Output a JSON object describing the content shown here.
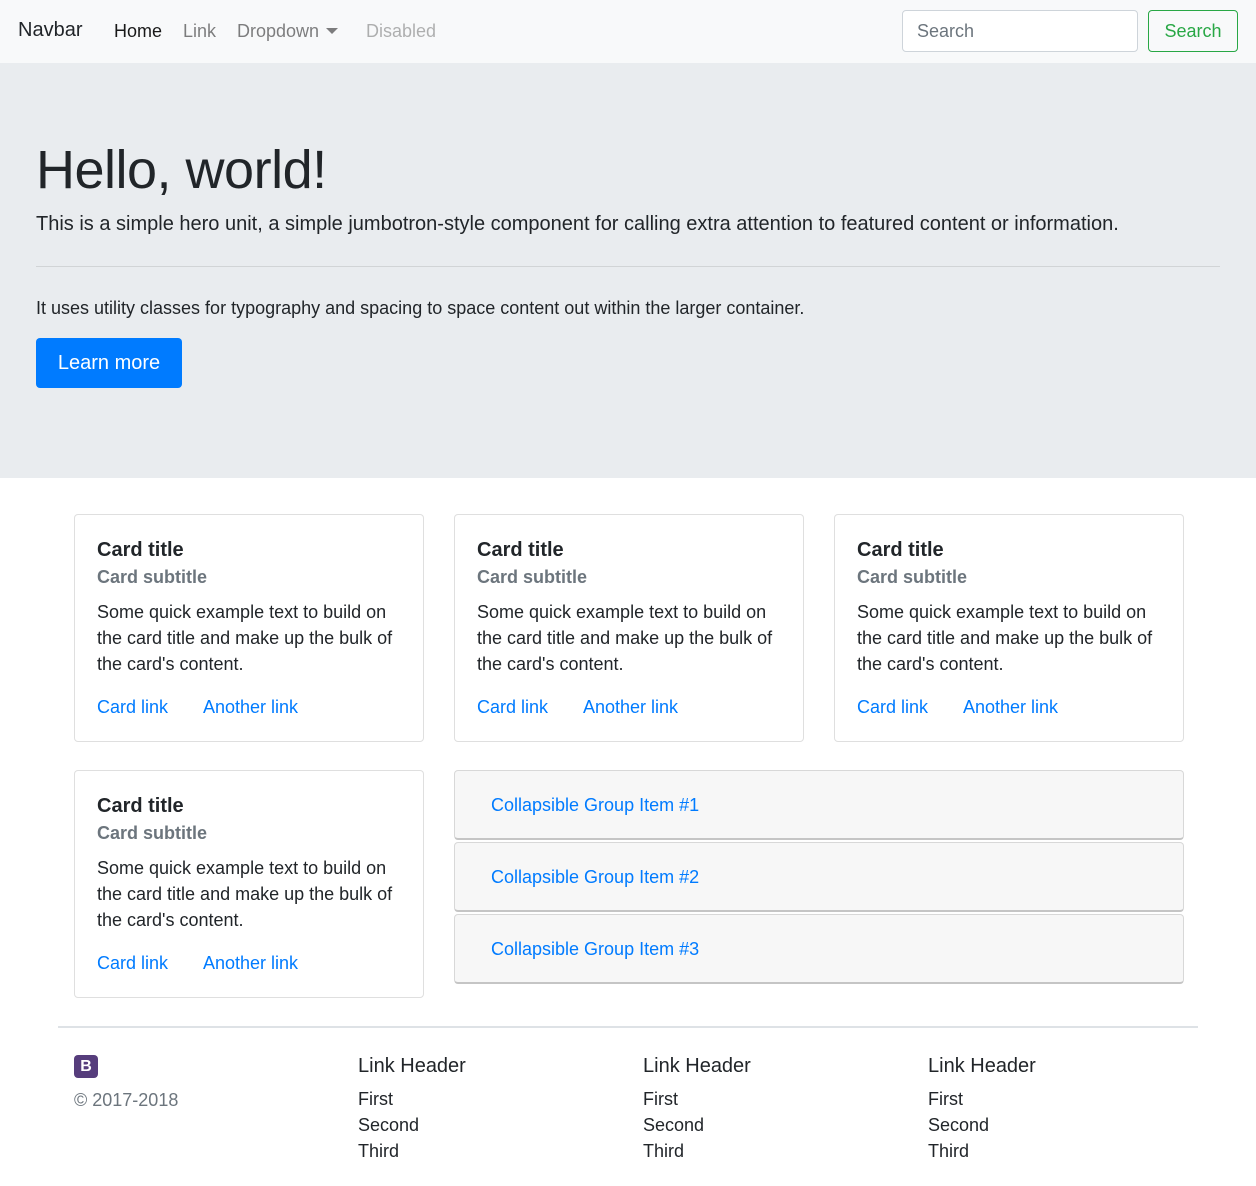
{
  "navbar": {
    "brand": "Navbar",
    "links": [
      "Home",
      "Link",
      "Dropdown",
      "Disabled"
    ],
    "search_placeholder": "Search",
    "search_button": "Search"
  },
  "hero": {
    "title": "Hello, world!",
    "lead": "This is a simple hero unit, a simple jumbotron-style component for calling extra attention to featured content or information.",
    "text": "It uses utility classes for typography and spacing to space content out within the larger container.",
    "button": "Learn more"
  },
  "cards": [
    {
      "title": "Card title",
      "subtitle": "Card subtitle",
      "text": "Some quick example text to build on the card title and make up the bulk of the card's content.",
      "link1": "Card link",
      "link2": "Another link"
    },
    {
      "title": "Card title",
      "subtitle": "Card subtitle",
      "text": "Some quick example text to build on the card title and make up the bulk of the card's content.",
      "link1": "Card link",
      "link2": "Another link"
    },
    {
      "title": "Card title",
      "subtitle": "Card subtitle",
      "text": "Some quick example text to build on the card title and make up the bulk of the card's content.",
      "link1": "Card link",
      "link2": "Another link"
    },
    {
      "title": "Card title",
      "subtitle": "Card subtitle",
      "text": "Some quick example text to build on the card title and make up the bulk of the card's content.",
      "link1": "Card link",
      "link2": "Another link"
    }
  ],
  "accordion": [
    "Collapsible Group Item #1",
    "Collapsible Group Item #2",
    "Collapsible Group Item #3"
  ],
  "footer": {
    "logo": "B",
    "copyright": "© 2017-2018",
    "columns": [
      {
        "header": "Link Header",
        "links": [
          "First",
          "Second",
          "Third"
        ]
      },
      {
        "header": "Link Header",
        "links": [
          "First",
          "Second",
          "Third"
        ]
      },
      {
        "header": "Link Header",
        "links": [
          "First",
          "Second",
          "Third"
        ]
      }
    ]
  },
  "colors": {
    "primary": "#007bff",
    "success": "#28a745",
    "jumbotron_bg": "#e9ecef",
    "navbar_bg": "#f8f9fa",
    "muted": "#6c757d",
    "logo_bg": "#563d7c"
  }
}
